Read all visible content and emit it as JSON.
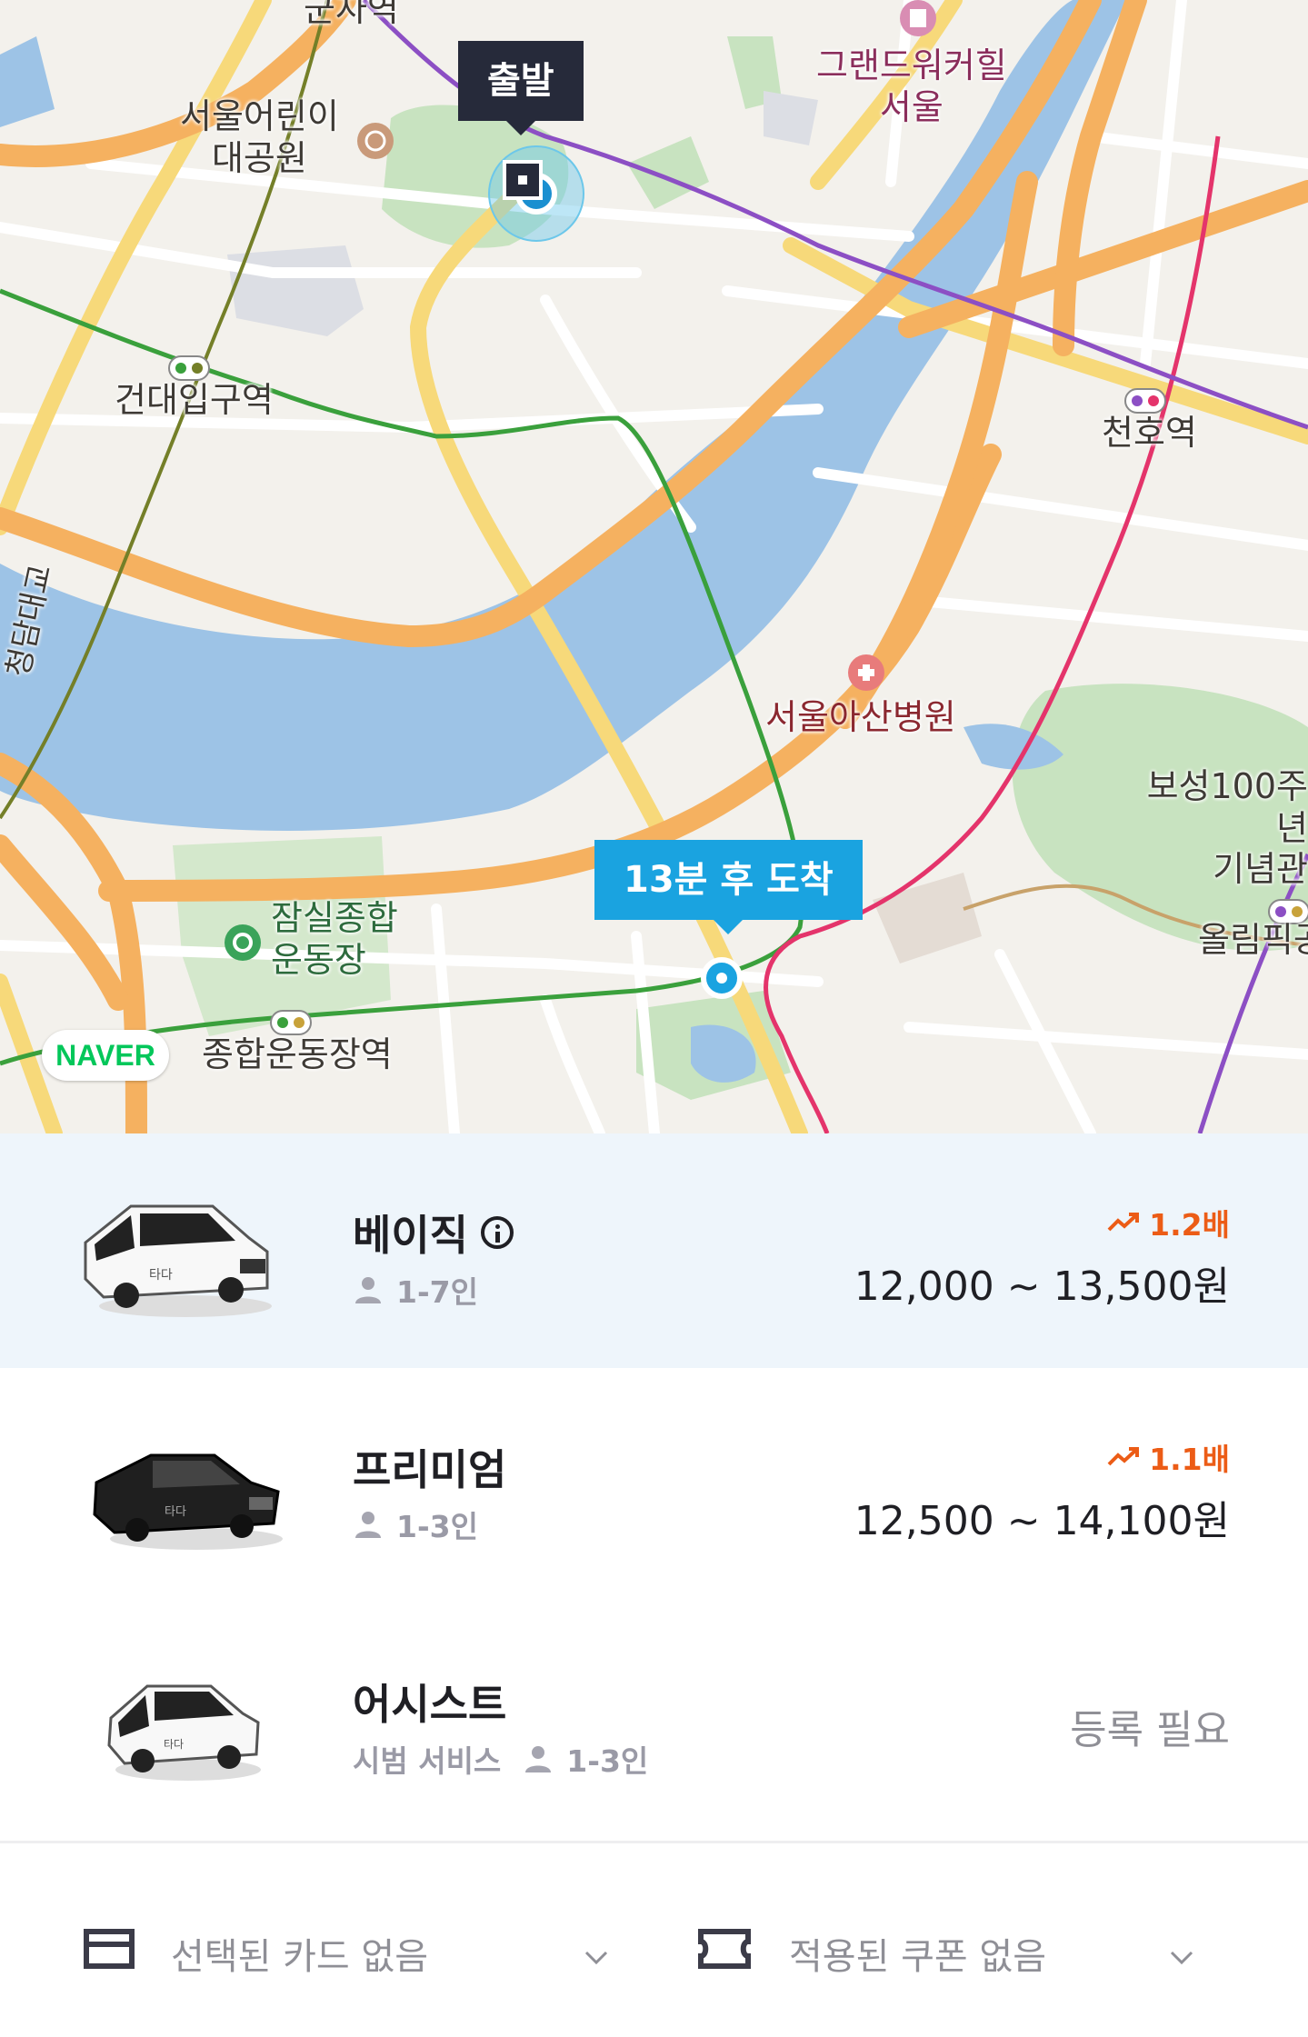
{
  "map": {
    "callouts": {
      "start": "출발",
      "arrival": "13분 후 도착"
    },
    "labels": {
      "gunja": "군자역",
      "childpark": "서울어린이\n대공원",
      "grandwalker": "그랜드워커힐\n서울",
      "konkuk": "건대입구역",
      "cheonho": "천호역",
      "cheongdam": "청담대교",
      "asan": "서울아산병원",
      "boseong": "보성100주년\n기념관",
      "olympic": "올림픽공",
      "jamsil": "잠실종합\n운동장",
      "sports_station": "종합운동장역"
    },
    "brand": "NAVER"
  },
  "rides": [
    {
      "name": "베이직",
      "info_icon": "info-icon",
      "capacity": "1-7인",
      "surge": "1.2배",
      "price": "12,000 ~ 13,500원",
      "selected": true,
      "car_color": "white-van"
    },
    {
      "name": "프리미엄",
      "capacity": "1-3인",
      "surge": "1.1배",
      "price": "12,500 ~ 14,100원",
      "selected": false,
      "car_color": "black-sedan"
    },
    {
      "name": "어시스트",
      "tag": "시범 서비스",
      "capacity": "1-3인",
      "status": "등록 필요",
      "selected": false,
      "car_color": "white-suv"
    }
  ],
  "payment": {
    "card": "선택된 카드 없음",
    "coupon": "적용된 쿠폰 없음"
  },
  "colors": {
    "selected_bg": "#eef5fb",
    "surge": "#ec5c16",
    "start_pin": "#262a3a",
    "arrival_pin": "#1aa3e0",
    "water": "#9dc3e6",
    "park": "#c8e3c0"
  }
}
